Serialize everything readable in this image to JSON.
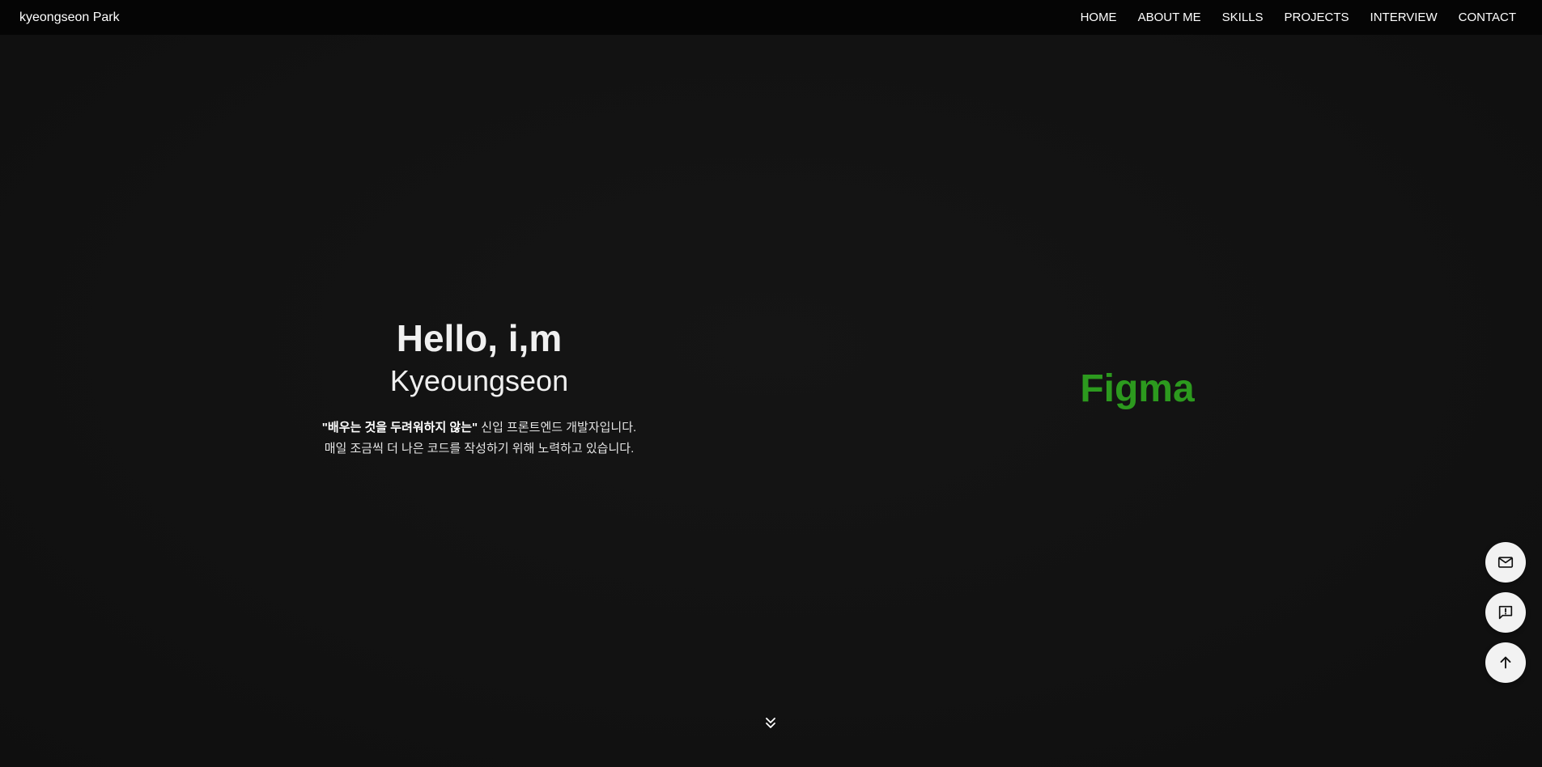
{
  "header": {
    "brand": "kyeongseon Park",
    "nav": [
      {
        "label": "HOME"
      },
      {
        "label": "ABOUT ME"
      },
      {
        "label": "SKILLS"
      },
      {
        "label": "PROJECTS"
      },
      {
        "label": "INTERVIEW"
      },
      {
        "label": "CONTACT"
      }
    ]
  },
  "hero": {
    "greeting": "Hello, i,m",
    "name": "Kyeoungseon",
    "desc_bold": "\"배우는 것을 두려워하지 않는\"",
    "desc_rest": " 신입 프론트엔드 개발자입니다.",
    "desc_line2": "매일 조금씩 더 나은 코드를 작성하기 위해 노력하고 있습니다."
  },
  "skill_rotator": {
    "current": "Figma",
    "color": "#2c9a1e"
  },
  "icons": {
    "scroll_down": "double-chevron-down-icon",
    "mail": "mail-icon",
    "feedback": "feedback-icon",
    "scroll_top": "arrow-up-icon"
  },
  "colors": {
    "background": "#111111",
    "header": "#050505",
    "fab": "#f2f2f2"
  }
}
